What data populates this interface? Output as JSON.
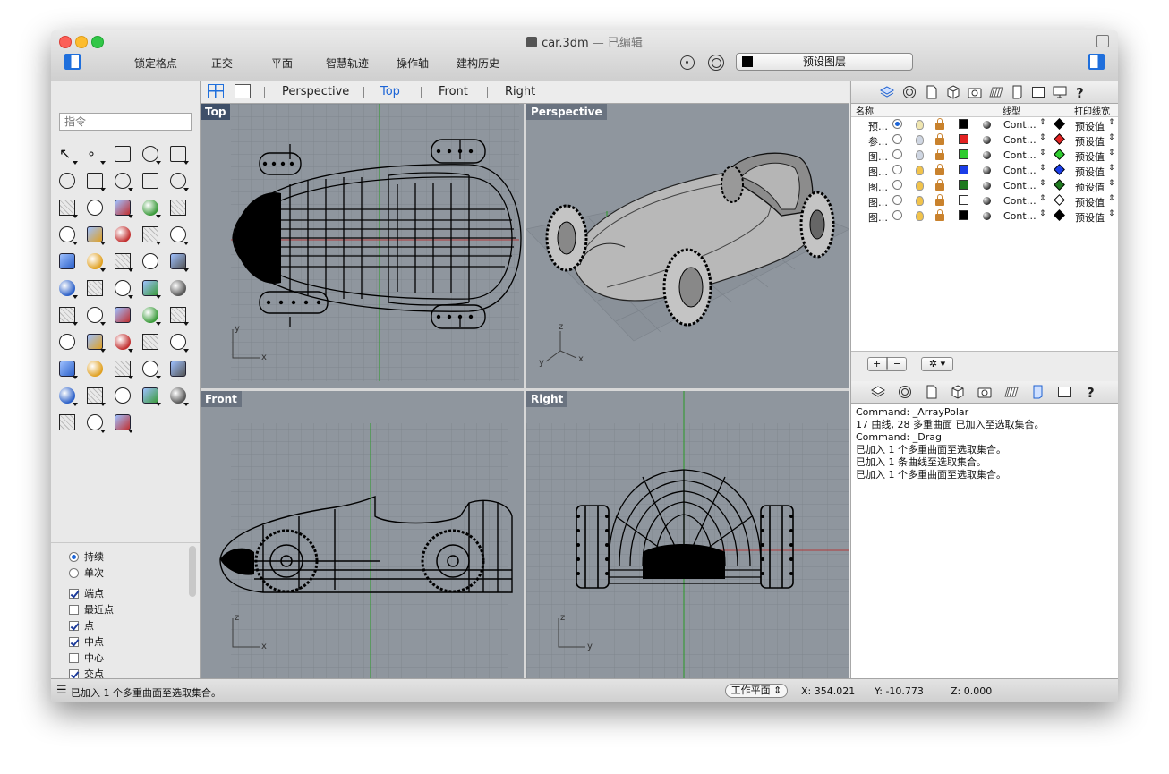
{
  "window": {
    "title": "car.3dm",
    "subtitle": "— 已编辑"
  },
  "toolbar": {
    "modes": [
      "锁定格点",
      "正交",
      "平面",
      "智慧轨迹",
      "操作轴",
      "建构历史"
    ],
    "layer_popup_label": "预设图层",
    "layer_swatch_color": "#000000"
  },
  "command": {
    "placeholder": "指令"
  },
  "tools": [
    "select-arrow-icon",
    "point-icon",
    "polyline-icon",
    "curve-icon",
    "circle-icon",
    "ellipse-icon",
    "arc-icon",
    "rectangle-icon",
    "polygon-icon",
    "fillet-icon",
    "surface-icon",
    "extrude-surface-icon",
    "box-icon",
    "boolean-icon",
    "cylinder-icon",
    "plane-surface-icon",
    "gear-transform-icon",
    "explode-icon",
    "split-icon",
    "trim-icon",
    "join-icon",
    "group-icon",
    "rotate-icon",
    "mirror-icon",
    "text-icon",
    "move-icon",
    "array-icon",
    "scale-icon",
    "solid-edit-icon",
    "dimension-icon",
    "grid-array-icon",
    "align-icon",
    "copy-icon",
    "checkmark-icon",
    "analyze-icon",
    "paint-icon",
    "zoom-icon",
    "zoom-window-icon",
    "zoom-extents-icon",
    "zoom-selected-icon",
    "rotate-view-icon",
    "car-icon",
    "plane-view-icon",
    "camera-target-icon",
    "light-icon",
    "lock-icon",
    "render-icon",
    "color-wheel-icon",
    "sphere-wire-icon",
    "globe-icon",
    "render-sphere-icon",
    "spotlight-icon",
    "hierarchy-icon"
  ],
  "osnap": {
    "mode_options": [
      {
        "label": "持续",
        "on": true
      },
      {
        "label": "单次",
        "on": false
      }
    ],
    "snaps": [
      {
        "label": "端点",
        "on": true
      },
      {
        "label": "最近点",
        "on": false
      },
      {
        "label": "点",
        "on": true
      },
      {
        "label": "中点",
        "on": true
      },
      {
        "label": "中心",
        "on": false
      },
      {
        "label": "交点",
        "on": true
      }
    ]
  },
  "viewport_tabs": [
    {
      "label": "Perspective",
      "active": false
    },
    {
      "label": "Top",
      "active": true
    },
    {
      "label": "Front",
      "active": false
    },
    {
      "label": "Right",
      "active": false
    }
  ],
  "viewports": [
    {
      "label": "Top",
      "active": true,
      "axis_x": "x",
      "axis_y": "y"
    },
    {
      "label": "Perspective",
      "active": false,
      "axis_x": "x",
      "axis_y": "y",
      "axis_z": "z"
    },
    {
      "label": "Front",
      "active": false,
      "axis_x": "x",
      "axis_y": "z"
    },
    {
      "label": "Right",
      "active": false,
      "axis_x": "y",
      "axis_y": "z"
    }
  ],
  "layers": {
    "headers": {
      "name": "名称",
      "linetype": "线型",
      "printwidth": "打印线宽"
    },
    "rows": [
      {
        "name": "预…",
        "current": true,
        "bulb": "#f0e6b0",
        "color": "#000000",
        "linetype": "Cont…",
        "print_color": "#000000",
        "print_width": "预设值"
      },
      {
        "name": "参…",
        "current": false,
        "bulb": "#cfd6e2",
        "color": "#e32222",
        "linetype": "Cont…",
        "print_color": "#e32222",
        "print_width": "预设值"
      },
      {
        "name": "图…",
        "current": false,
        "bulb": "#cfd6e2",
        "color": "#2fcc2f",
        "linetype": "Cont…",
        "print_color": "#2fcc2f",
        "print_width": "预设值"
      },
      {
        "name": "图…",
        "current": false,
        "bulb": "#f2c34a",
        "color": "#1a3de8",
        "linetype": "Cont…",
        "print_color": "#1a3de8",
        "print_width": "预设值"
      },
      {
        "name": "图…",
        "current": false,
        "bulb": "#f2c34a",
        "color": "#1f7a1f",
        "linetype": "Cont…",
        "print_color": "#1f7a1f",
        "print_width": "预设值"
      },
      {
        "name": "图…",
        "current": false,
        "bulb": "#f2c34a",
        "color": "#ffffff",
        "linetype": "Cont…",
        "print_color": "#ffffff",
        "print_width": "预设值"
      },
      {
        "name": "图…",
        "current": false,
        "bulb": "#f2c34a",
        "color": "#000000",
        "linetype": "Cont…",
        "print_color": "#000000",
        "print_width": "预设值"
      }
    ]
  },
  "history": [
    "Command: _ArrayPolar",
    "17 曲线, 28 多重曲面 已加入至选取集合。",
    "Command: _Drag",
    "已加入 1 个多重曲面至选取集合。",
    "已加入 1 条曲线至选取集合。",
    "已加入 1 个多重曲面至选取集合。"
  ],
  "status": {
    "message": "已加入 1 个多重曲面至选取集合。",
    "cplane": "工作平面",
    "x": "X: 354.021",
    "y": "Y: -10.773",
    "z": "Z: 0.000"
  }
}
